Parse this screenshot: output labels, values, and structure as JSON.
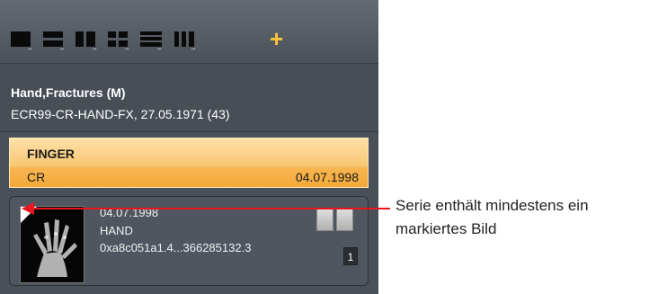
{
  "toolbar": {
    "layout_buttons": [
      {
        "name": "layout-1x1-icon"
      },
      {
        "name": "layout-1x2-icon"
      },
      {
        "name": "layout-2x1-icon"
      },
      {
        "name": "layout-2x2-icon"
      },
      {
        "name": "layout-1x3-icon"
      },
      {
        "name": "layout-3x1-icon"
      }
    ],
    "add_label": "+"
  },
  "patient": {
    "name": "Hand,Fractures (M)",
    "info": "ECR99-CR-HAND-FX, 27.05.1971 (43)"
  },
  "study": {
    "title": "FINGER",
    "modality": "CR",
    "date": "04.07.1998"
  },
  "series": {
    "date": "04.07.1998",
    "body_part": "HAND",
    "uid": "0xa8c051a1.4...366285132.3",
    "image_count": "1"
  },
  "callout": {
    "text": "Serie enthält mindestens ein markiertes Bild"
  },
  "colors": {
    "accent_plus": "#ffc43a",
    "selected_study": "#f6b148",
    "callout_red": "#e8161f"
  }
}
